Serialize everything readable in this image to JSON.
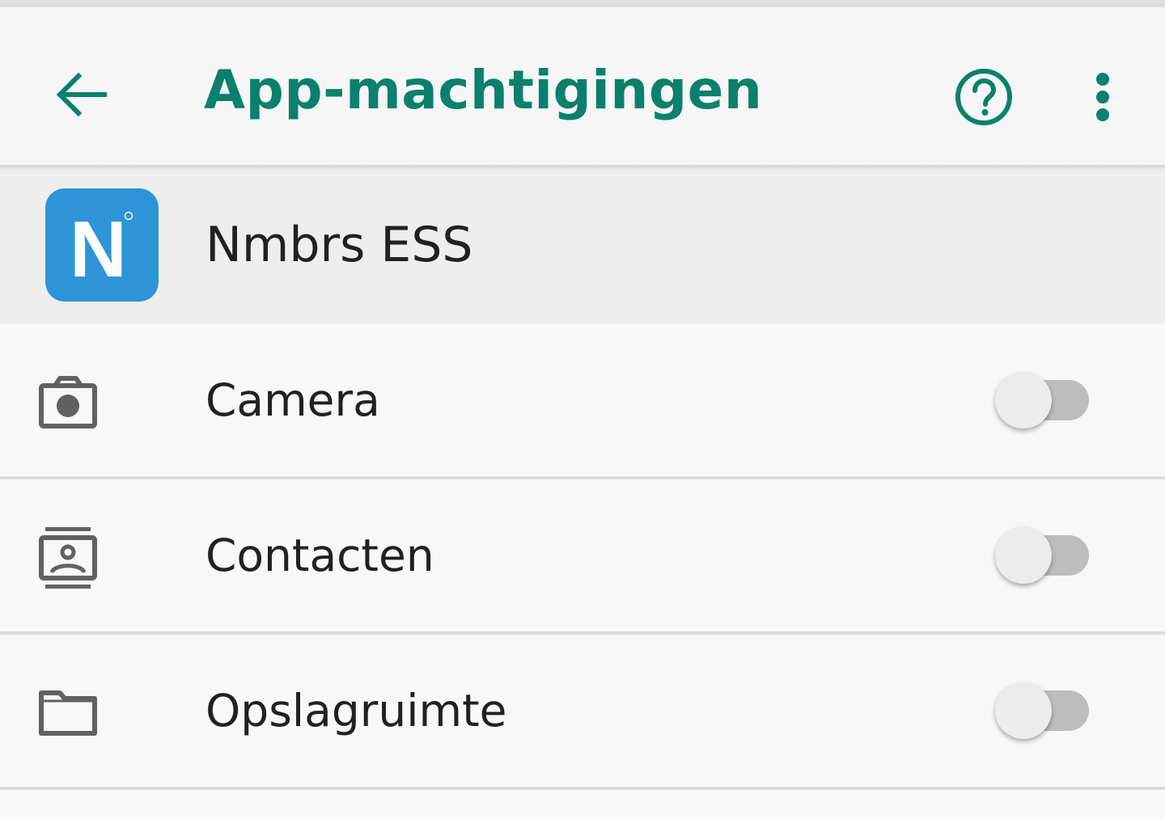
{
  "toolbar": {
    "title": "App-machtigingen",
    "accent_color": "#0b806d",
    "back_icon": "arrow-left-icon",
    "help_icon": "help-circle-icon",
    "more_icon": "more-vertical-icon"
  },
  "app": {
    "name": "Nmbrs ESS",
    "icon_letter": "N",
    "icon_color": "#2e94d8"
  },
  "permissions": [
    {
      "label": "Camera",
      "icon": "camera-icon",
      "enabled": false
    },
    {
      "label": "Contacten",
      "icon": "contacts-icon",
      "enabled": false
    },
    {
      "label": "Opslagruimte",
      "icon": "folder-icon",
      "enabled": false
    }
  ]
}
